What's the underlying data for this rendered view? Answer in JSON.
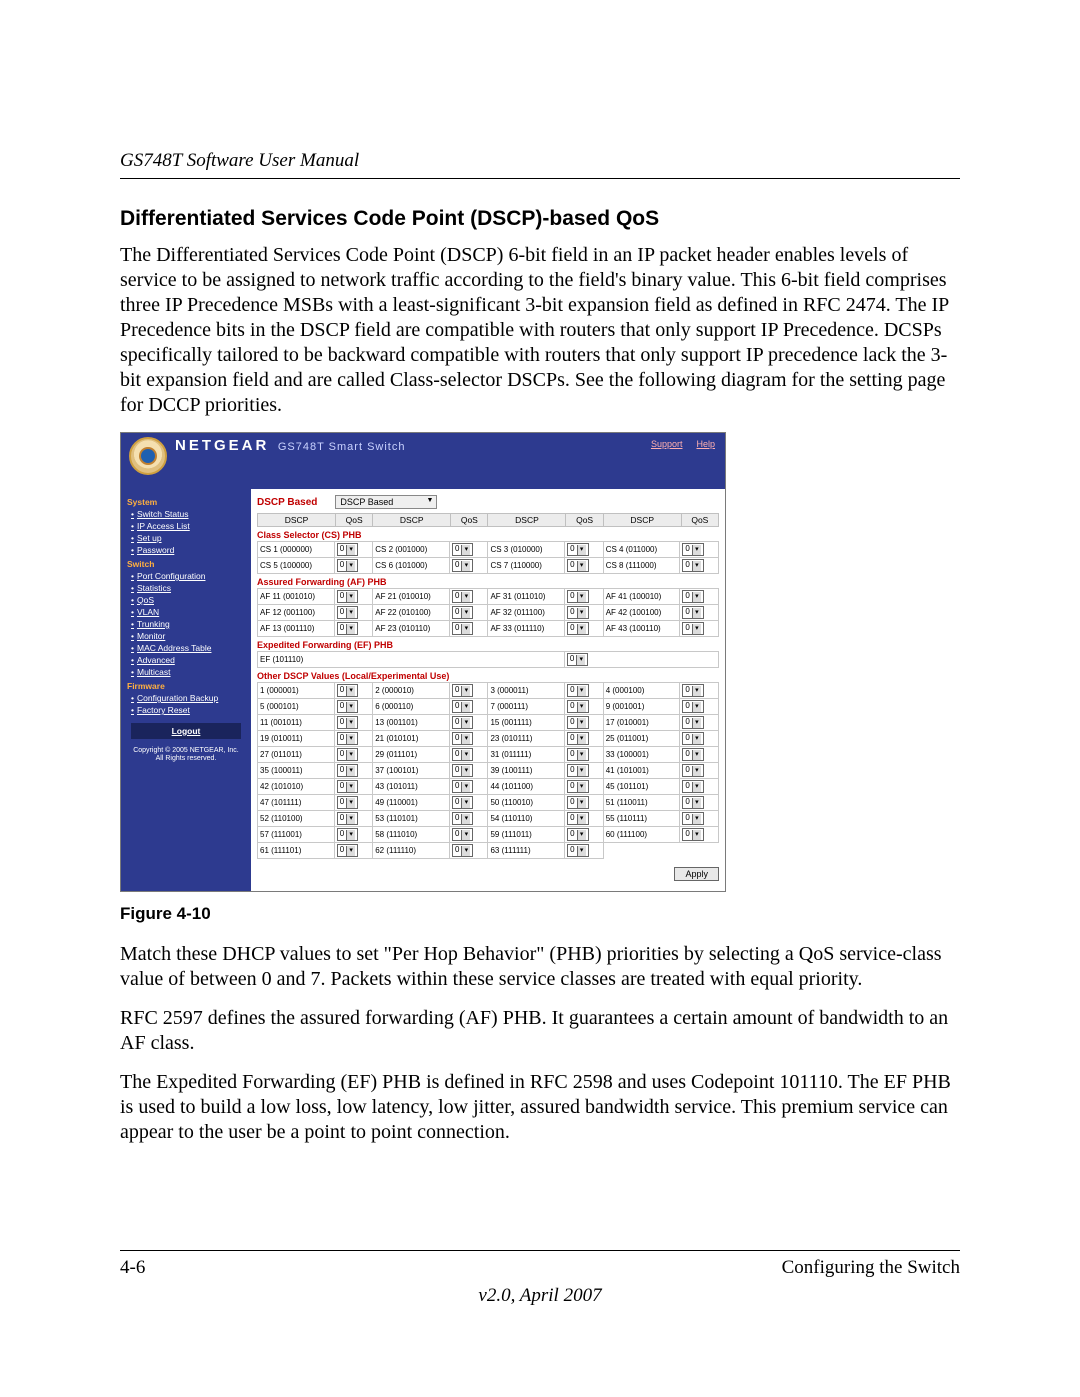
{
  "doc": {
    "running_head": "GS748T Software User Manual",
    "section_title": "Differentiated Services Code Point (DSCP)-based QoS",
    "para1": "The Differentiated Services Code Point (DSCP) 6-bit field in an IP packet header enables levels of service to be assigned to network traffic according to the field's binary value. This 6-bit field comprises three IP Precedence MSBs with a least-significant 3-bit expansion field as defined in RFC 2474. The IP Precedence bits in the DSCP field are compatible with routers that only support IP Precedence. DCSPs specifically tailored to be backward compatible with routers that only support IP precedence lack the 3-bit expansion field and are called Class-selector DSCPs. See the following diagram for the setting page for DCCP priorities.",
    "fig_caption": "Figure 4-10",
    "para2": "Match these DHCP values to set \"Per Hop Behavior\" (PHB) priorities by selecting a QoS service-class value of between 0 and 7. Packets within these service classes are treated with equal priority.",
    "para3": "RFC 2597 defines the assured forwarding (AF) PHB. It guarantees a certain amount of bandwidth to an AF class.",
    "para4": "The Expedited Forwarding (EF) PHB is defined in RFC 2598 and uses Codepoint 101110. The EF PHB is used to build a low loss, low latency, low jitter, assured bandwidth service. This premium service can appear to the user be a point to point connection.",
    "footer_left": "4-6",
    "footer_right": "Configuring the Switch",
    "footer_version": "v2.0, April 2007"
  },
  "shot": {
    "brand": "NETGEAR",
    "product": "GS748T Smart Switch",
    "support": "Support",
    "help": "Help",
    "page_title": "DSCP Based",
    "mode_value": "DSCP Based",
    "apply": "Apply",
    "col": {
      "dscp": "DSCP",
      "qos": "QoS"
    },
    "nav": {
      "groups": [
        {
          "head": "System",
          "items": [
            "Switch Status",
            "IP Access List",
            "Set up",
            "Password"
          ]
        },
        {
          "head": "Switch",
          "items": [
            "Port Configuration",
            "Statistics",
            "QoS",
            "VLAN",
            "Trunking",
            "Monitor",
            "MAC Address Table",
            "Advanced",
            "Multicast"
          ]
        },
        {
          "head": "Firmware",
          "items": [
            "Configuration Backup",
            "Factory Reset"
          ]
        }
      ],
      "logout": "Logout",
      "copyright1": "Copyright © 2005 NETGEAR, Inc.",
      "copyright2": "All Rights reserved."
    },
    "groups": {
      "cs": {
        "title": "Class Selector (CS) PHB",
        "rows": [
          [
            "CS 1 (000000)",
            "CS 2 (001000)",
            "CS 3 (010000)",
            "CS 4 (011000)"
          ],
          [
            "CS 5 (100000)",
            "CS 6 (101000)",
            "CS 7 (110000)",
            "CS 8 (111000)"
          ]
        ]
      },
      "af": {
        "title": "Assured Forwarding (AF) PHB",
        "rows": [
          [
            "AF 11 (001010)",
            "AF 21 (010010)",
            "AF 31 (011010)",
            "AF 41 (100010)"
          ],
          [
            "AF 12 (001100)",
            "AF 22 (010100)",
            "AF 32 (011100)",
            "AF 42 (100100)"
          ],
          [
            "AF 13 (001110)",
            "AF 23 (010110)",
            "AF 33 (011110)",
            "AF 43 (100110)"
          ]
        ]
      },
      "ef": {
        "title": "Expedited Forwarding (EF) PHB",
        "rows": [
          [
            "EF (101110)"
          ]
        ]
      },
      "other": {
        "title": "Other DSCP Values (Local/Experimental Use)",
        "rows": [
          [
            "1 (000001)",
            "2 (000010)",
            "3 (000011)",
            "4 (000100)"
          ],
          [
            "5 (000101)",
            "6 (000110)",
            "7 (000111)",
            "9 (001001)"
          ],
          [
            "11 (001011)",
            "13 (001101)",
            "15 (001111)",
            "17 (010001)"
          ],
          [
            "19 (010011)",
            "21 (010101)",
            "23 (010111)",
            "25 (011001)"
          ],
          [
            "27 (011011)",
            "29 (011101)",
            "31 (011111)",
            "33 (100001)"
          ],
          [
            "35 (100011)",
            "37 (100101)",
            "39 (100111)",
            "41 (101001)"
          ],
          [
            "42 (101010)",
            "43 (101011)",
            "44 (101100)",
            "45 (101101)"
          ],
          [
            "47 (101111)",
            "49 (110001)",
            "50 (110010)",
            "51 (110011)"
          ],
          [
            "52 (110100)",
            "53 (110101)",
            "54 (110110)",
            "55 (110111)"
          ],
          [
            "57 (111001)",
            "58 (111010)",
            "59 (111011)",
            "60 (111100)"
          ],
          [
            "61 (111101)",
            "62 (111110)",
            "63 (111111)"
          ]
        ]
      }
    },
    "qos_default": "0"
  }
}
